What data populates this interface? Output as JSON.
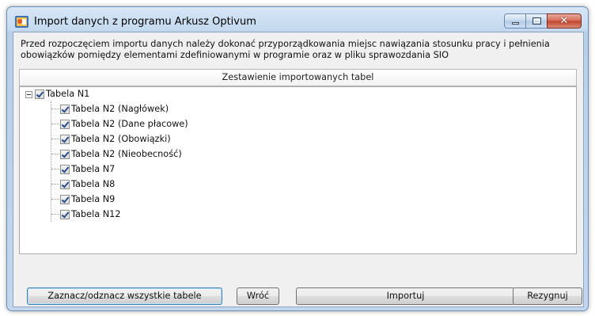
{
  "window": {
    "title": "Import danych z programu Arkusz Optivum",
    "minimize_label": "",
    "maximize_label": "",
    "close_label": "✕"
  },
  "description": "Przed rozpoczęciem importu danych należy dokonać przyporządkowania miejsc nawiązania stosunku pracy i pełnienia obowiązków pomiędzy elementami zdefiniowanymi w programie oraz w pliku sprawozdania SIO",
  "list_header": "Zestawienie importowanych tabel",
  "tree": {
    "root": {
      "label": "Tabela N1",
      "checked": true,
      "expanded": true
    },
    "children": [
      {
        "label": "Tabela N2 (Nagłówek)",
        "checked": true
      },
      {
        "label": "Tabela N2 (Dane płacowe)",
        "checked": true
      },
      {
        "label": "Tabela N2 (Obowiązki)",
        "checked": true
      },
      {
        "label": "Tabela N2 (Nieobecność)",
        "checked": true
      },
      {
        "label": "Tabela N7",
        "checked": true
      },
      {
        "label": "Tabela N8",
        "checked": true
      },
      {
        "label": "Tabela N9",
        "checked": true
      },
      {
        "label": "Tabela N12",
        "checked": true
      }
    ]
  },
  "buttons": {
    "toggle_all": "Zaznacz/odznacz wszystkie tabele",
    "back": "Wróć",
    "import": "Importuj",
    "cancel": "Rezygnuj"
  },
  "colors": {
    "window_frame": "#c2d7ee",
    "close_button": "#c2402a",
    "checkmark": "#2a4d8c",
    "default_button_border": "#3c7fb1"
  }
}
